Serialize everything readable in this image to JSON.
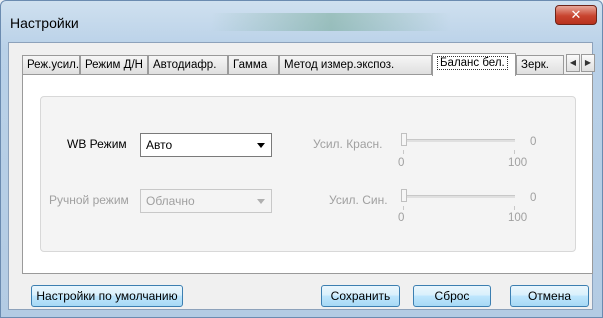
{
  "window": {
    "title": "Настройки"
  },
  "tabs": [
    {
      "label": "Реж.усил."
    },
    {
      "label": "Режим Д/Н"
    },
    {
      "label": "Автодиафр."
    },
    {
      "label": "Гамма"
    },
    {
      "label": "Метод измер.экспоз."
    },
    {
      "label": "Баланс бел."
    },
    {
      "label": "Зерк."
    }
  ],
  "active_tab": "Баланс бел.",
  "wb": {
    "mode_label": "WB Режим",
    "mode_value": "Авто",
    "manual_label": "Ручной режим",
    "manual_value": "Облачно"
  },
  "sliders": {
    "red": {
      "label": "Усил. Красн.",
      "value": "0",
      "min": "0",
      "max": "100"
    },
    "blue": {
      "label": "Усил. Син.",
      "value": "0",
      "min": "0",
      "max": "100"
    }
  },
  "buttons": {
    "defaults": "Настройки по умолчанию",
    "save": "Сохранить",
    "reset": "Сброс",
    "cancel": "Отмена"
  },
  "icons": {
    "close": "close-icon",
    "scroll_left": "arrow-left-icon",
    "scroll_right": "arrow-right-icon",
    "dropdown": "chevron-down-icon"
  }
}
